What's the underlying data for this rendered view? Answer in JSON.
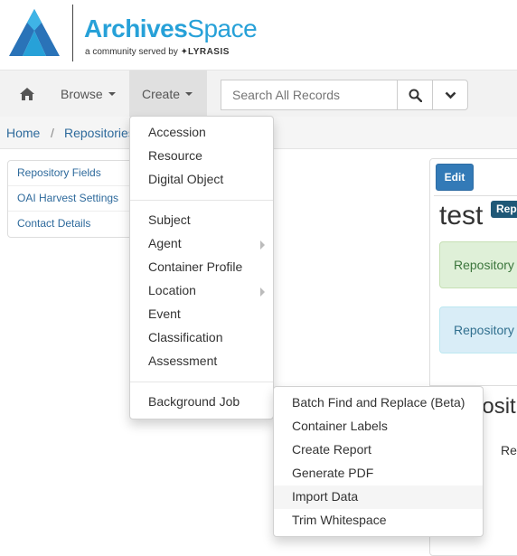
{
  "header": {
    "brand_bold": "Archives",
    "brand_light": "Space",
    "tagline": "a community served by",
    "tagline_org": "LYRASIS"
  },
  "nav": {
    "home_icon": "home-icon",
    "browse_label": "Browse",
    "create_label": "Create",
    "search_placeholder": "Search All Records"
  },
  "breadcrumb": {
    "home": "Home",
    "separator": "/",
    "repositories": "Repositories"
  },
  "sidebar": {
    "items": [
      {
        "label": "Repository Fields"
      },
      {
        "label": "OAI Harvest Settings"
      },
      {
        "label": "Contact Details"
      }
    ]
  },
  "content": {
    "edit_label": "Edit",
    "title": "test",
    "badge": "Rep",
    "panel_green": "Repository",
    "panel_blue": "Repository",
    "section_heading": "posit",
    "row_text": "Re"
  },
  "create_menu": {
    "group1": [
      "Accession",
      "Resource",
      "Digital Object"
    ],
    "group2": [
      "Subject",
      "Agent",
      "Container Profile",
      "Location",
      "Event",
      "Classification",
      "Assessment"
    ],
    "background_job": "Background Job"
  },
  "background_job_menu": {
    "items": [
      "Batch Find and Replace (Beta)",
      "Container Labels",
      "Create Report",
      "Generate PDF",
      "Import Data",
      "Trim Whitespace"
    ],
    "highlighted": "Import Data"
  },
  "colors": {
    "brand": "#27a1d8",
    "link": "#2e6a9c",
    "edit_button": "#337ab7",
    "badge": "#1f5877"
  }
}
